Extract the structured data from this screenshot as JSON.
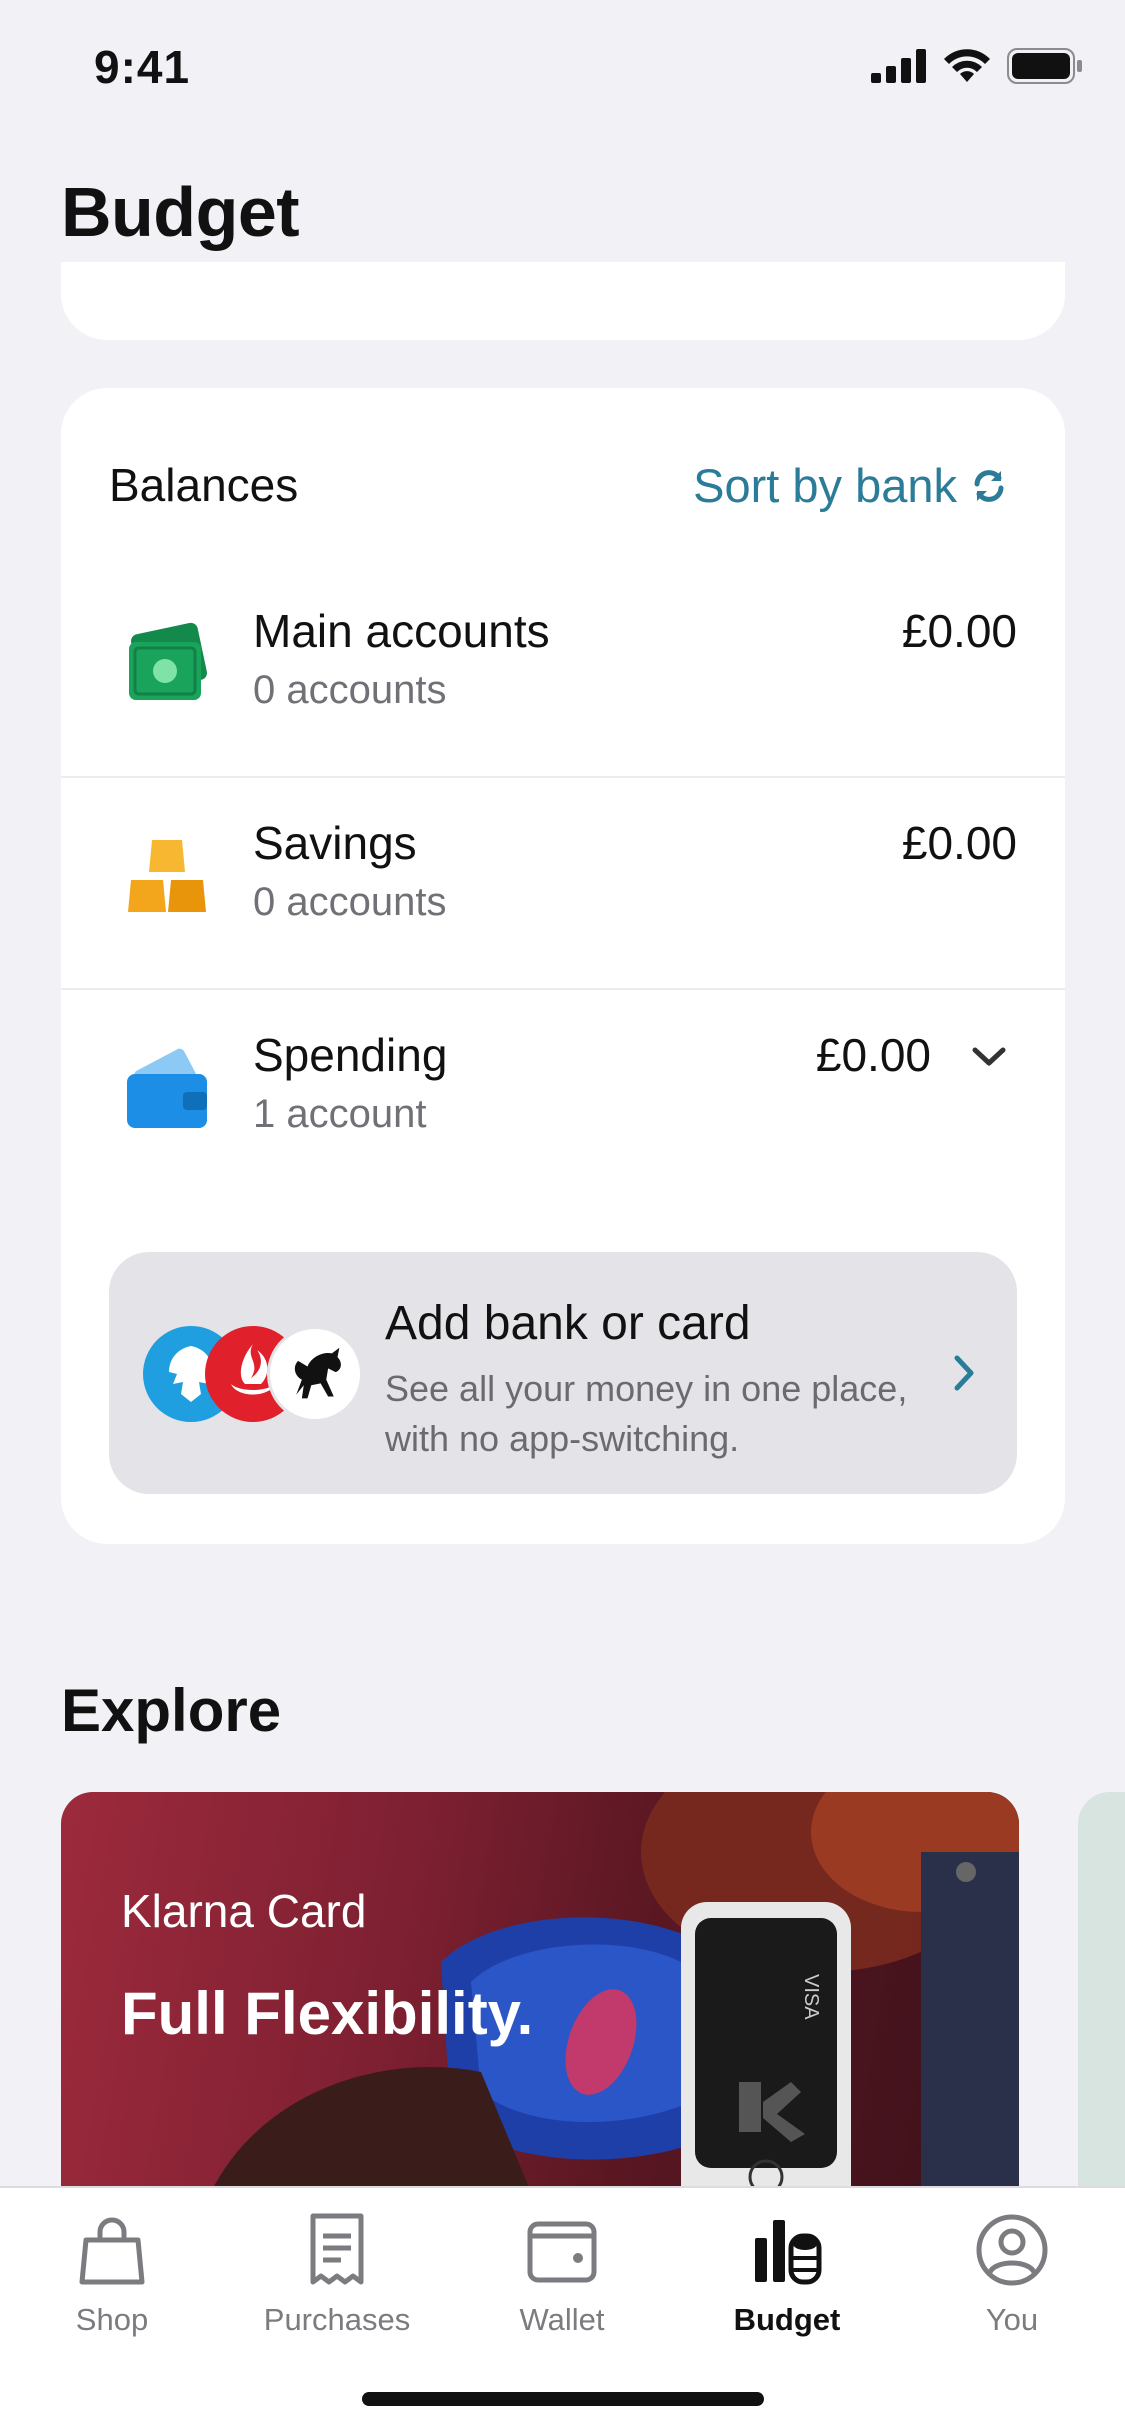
{
  "status": {
    "time": "9:41"
  },
  "header": {
    "title": "Budget"
  },
  "balances": {
    "title": "Balances",
    "sort_label": "Sort by bank",
    "accounts": [
      {
        "name": "Main accounts",
        "count": "0 accounts",
        "amount": "£0.00",
        "icon": "cash-icon"
      },
      {
        "name": "Savings",
        "count": "0 accounts",
        "amount": "£0.00",
        "icon": "gold-bars-icon"
      },
      {
        "name": "Spending",
        "count": "1 account",
        "amount": "£0.00",
        "icon": "wallet-icon"
      }
    ],
    "add_bank": {
      "title": "Add bank or card",
      "subtitle": "See all your money in one place, with no app-switching."
    }
  },
  "explore": {
    "title": "Explore",
    "promo": {
      "brand": "Klarna Card",
      "headline": "Full Flexibility."
    }
  },
  "tabs": [
    {
      "label": "Shop",
      "icon": "shopping-bag-icon",
      "active": false
    },
    {
      "label": "Purchases",
      "icon": "receipt-icon",
      "active": false
    },
    {
      "label": "Wallet",
      "icon": "wallet-icon",
      "active": false
    },
    {
      "label": "Budget",
      "icon": "budget-icon",
      "active": true
    },
    {
      "label": "You",
      "icon": "profile-icon",
      "active": false
    }
  ],
  "colors": {
    "accent": "#2b7c99",
    "background": "#f1f1f6",
    "cash_green": "#1aa35a",
    "savings_gold": "#f3a51b",
    "wallet_blue": "#1c8ee6"
  }
}
